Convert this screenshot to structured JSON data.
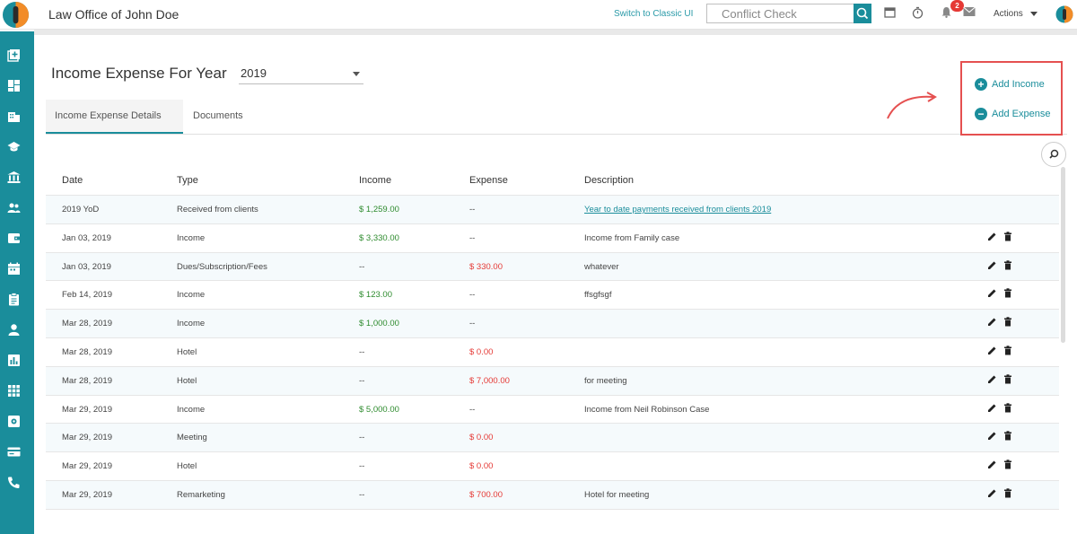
{
  "header": {
    "firm_name": "Law Office of John Doe",
    "classic_link": "Switch to Classic UI",
    "conflict_placeholder": "Conflict Check",
    "notification_count": "2",
    "actions_label": "Actions"
  },
  "sidebar": {
    "items": [
      "add-icon",
      "dashboard-icon",
      "building-icon",
      "graduation-icon",
      "bank-icon",
      "people-icon",
      "wallet-icon",
      "calendar-icon",
      "clipboard-icon",
      "person-icon",
      "chart-icon",
      "apps-icon",
      "settings-icon",
      "card-icon",
      "phone-icon"
    ]
  },
  "page": {
    "title": "Income Expense For Year",
    "year": "2019"
  },
  "tabs": [
    {
      "label": "Income Expense Details",
      "active": true
    },
    {
      "label": "Documents",
      "active": false
    }
  ],
  "actions": {
    "add_income": "Add Income",
    "add_expense": "Add Expense"
  },
  "table": {
    "headers": {
      "date": "Date",
      "type": "Type",
      "income": "Income",
      "expense": "Expense",
      "description": "Description"
    },
    "rows": [
      {
        "date": "2019 YoD",
        "type": "Received from clients",
        "income": "$ 1,259.00",
        "expense": "--",
        "description": "Year to date payments received from clients 2019"
      },
      {
        "date": "Jan 03, 2019",
        "type": "Income",
        "income": "$ 3,330.00",
        "expense": "--",
        "description": "Income from Family case"
      },
      {
        "date": "Jan 03, 2019",
        "type": "Dues/Subscription/Fees",
        "income": "--",
        "expense": "$ 330.00",
        "description": "whatever"
      },
      {
        "date": "Feb 14, 2019",
        "type": "Income",
        "income": "$ 123.00",
        "expense": "--",
        "description": "ffsgfsgf"
      },
      {
        "date": "Mar 28, 2019",
        "type": "Income",
        "income": "$ 1,000.00",
        "expense": "--",
        "description": ""
      },
      {
        "date": "Mar 28, 2019",
        "type": "Hotel",
        "income": "--",
        "expense": "$ 0.00",
        "description": ""
      },
      {
        "date": "Mar 28, 2019",
        "type": "Hotel",
        "income": "--",
        "expense": "$ 7,000.00",
        "description": "for meeting"
      },
      {
        "date": "Mar 29, 2019",
        "type": "Income",
        "income": "$ 5,000.00",
        "expense": "--",
        "description": "Income from Neil Robinson Case"
      },
      {
        "date": "Mar 29, 2019",
        "type": "Meeting",
        "income": "--",
        "expense": "$ 0.00",
        "description": ""
      },
      {
        "date": "Mar 29, 2019",
        "type": "Hotel",
        "income": "--",
        "expense": "$ 0.00",
        "description": ""
      },
      {
        "date": "Mar 29, 2019",
        "type": "Remarketing",
        "income": "--",
        "expense": "$ 700.00",
        "description": "Hotel for meeting"
      }
    ]
  },
  "colors": {
    "brand": "#1a8d9b",
    "income": "#2e8b2e",
    "expense": "#e53935",
    "highlight": "#e55050"
  }
}
